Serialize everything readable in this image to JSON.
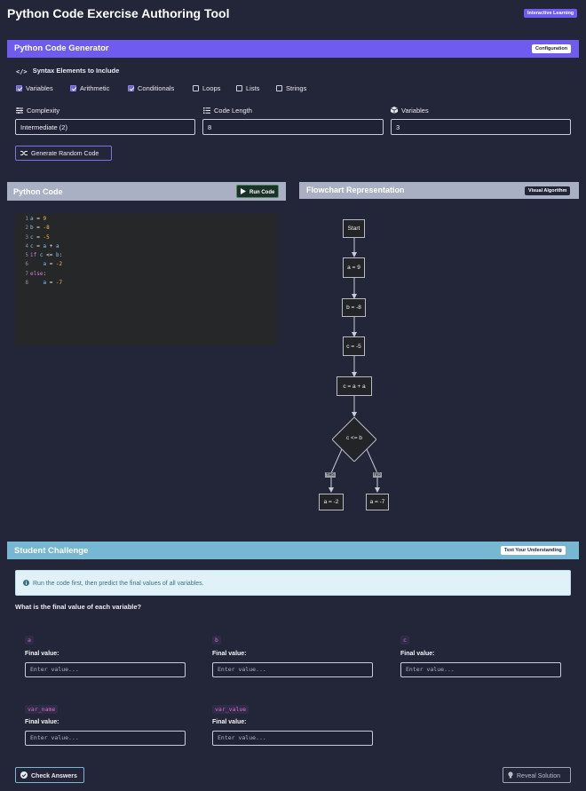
{
  "app": {
    "title": "Python Code Exercise Authoring Tool",
    "badge": "Interactive Learning"
  },
  "generator": {
    "title": "Python Code Generator",
    "badge": "Configuration",
    "syntax_label": "Syntax Elements to Include",
    "checkboxes": [
      {
        "label": "Variables",
        "checked": true
      },
      {
        "label": "Arithmetic",
        "checked": true
      },
      {
        "label": "Conditionals",
        "checked": true
      },
      {
        "label": "Loops",
        "checked": false
      },
      {
        "label": "Lists",
        "checked": false
      },
      {
        "label": "Strings",
        "checked": false
      }
    ],
    "complexity_label": "Complexity",
    "complexity_value": "Intermediate (2)",
    "length_label": "Code Length",
    "length_value": "8",
    "variables_label": "Variables",
    "variables_value": "3",
    "generate_button": "Generate Random Code"
  },
  "code_panel": {
    "title": "Python Code",
    "run_button": "Run Code",
    "lines": [
      {
        "n": "1",
        "text": "a = 9"
      },
      {
        "n": "2",
        "text": "b = -8"
      },
      {
        "n": "3",
        "text": "c = -5"
      },
      {
        "n": "4",
        "text": "c = a + a"
      },
      {
        "n": "5",
        "text": "if c <= b:"
      },
      {
        "n": "6",
        "text": "    a = -2"
      },
      {
        "n": "7",
        "text": "else:"
      },
      {
        "n": "8",
        "text": "    a = -7"
      }
    ]
  },
  "flowchart": {
    "title": "Flowchart Representation",
    "badge": "Visual Algorithm",
    "nodes": {
      "start": "Start",
      "n1": "a = 9",
      "n2": "b = -8",
      "n3": "c = -5",
      "n4": "c = a + a",
      "decision": "c <= b",
      "yes_label": "Yes",
      "no_label": "No",
      "yes_node": "a = -2",
      "no_node": "a = -7"
    }
  },
  "challenge": {
    "title": "Student Challenge",
    "badge": "Text Your Understanding",
    "info": "Run the code first, then predict the final values of all variables.",
    "question": "What is the final value of each variable?",
    "final_label": "Final value:",
    "placeholder": "Enter value...",
    "variables": [
      "a",
      "b",
      "c",
      "var_name",
      "var_value"
    ],
    "check_button": "Check Answers",
    "reveal_button": "Reveal Solution"
  },
  "colors": {
    "generator_header": "#6f5bf0",
    "panel_header": "#aab0c4",
    "challenge_header": "#76b7d2",
    "info_box": "#e0f2f8",
    "background": "#232638"
  }
}
